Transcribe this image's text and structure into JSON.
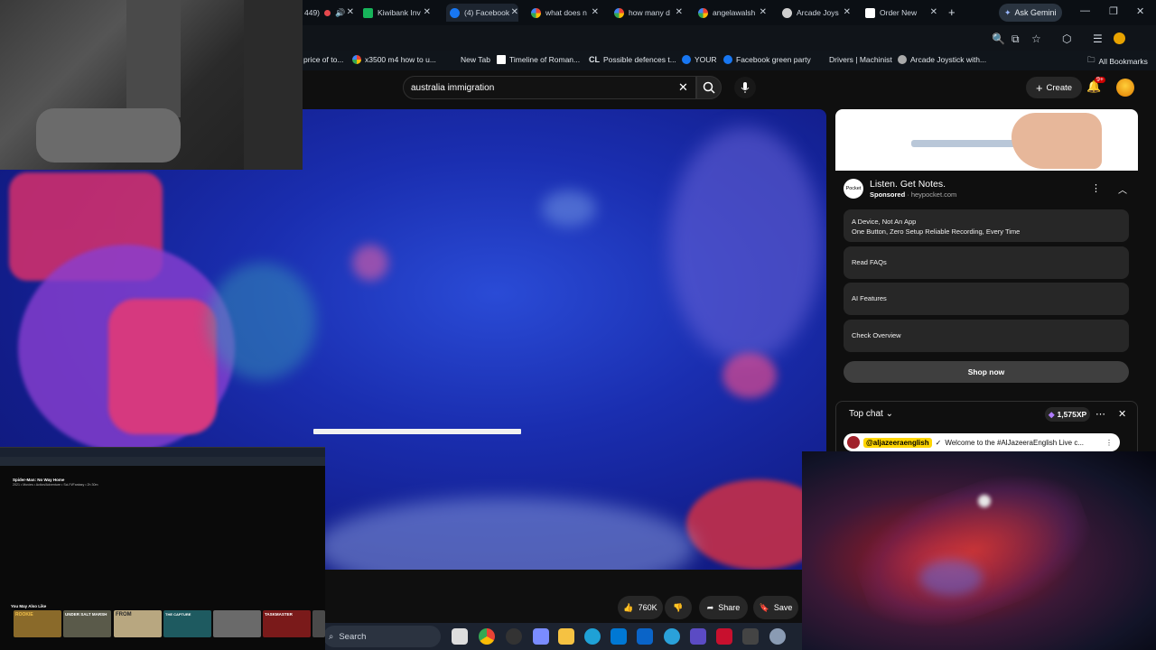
{
  "browser": {
    "tabs": [
      {
        "label": "449)"
      },
      {
        "label": "Kiwibank Inv"
      },
      {
        "label": "(4) Facebook"
      },
      {
        "label": "what does n"
      },
      {
        "label": "how many d"
      },
      {
        "label": "angelawalsh"
      },
      {
        "label": "Arcade Joys"
      },
      {
        "label": "Order New"
      }
    ],
    "new_tab": "+",
    "ask_gemini": "Ask Gemini",
    "bookmarks": [
      {
        "label": "price of to..."
      },
      {
        "label": "x3500 m4 how to u..."
      },
      {
        "label": "New Tab"
      },
      {
        "label": "Timeline of Roman..."
      },
      {
        "label": "Possible defences t..."
      },
      {
        "label": "YOUR"
      },
      {
        "label": "Facebook green party"
      },
      {
        "label": "Drivers | Machinist"
      },
      {
        "label": "Arcade Joystick with..."
      }
    ],
    "all_bookmarks": "All Bookmarks"
  },
  "youtube": {
    "search": {
      "value": "australia immigration"
    },
    "create_label": "Create",
    "notifications_badge": "9+",
    "ad": {
      "title": "Listen. Get Notes.",
      "sponsored": "Sponsored",
      "domain": "heypocket.com",
      "logo_text": "Pocket",
      "rows": [
        {
          "title": "A Device, Not An App",
          "sub": "One Button, Zero Setup Reliable Recording, Every Time"
        },
        {
          "title": "Read FAQs",
          "sub": ""
        },
        {
          "title": "AI Features",
          "sub": ""
        },
        {
          "title": "Check Overview",
          "sub": ""
        }
      ],
      "cta": "Shop now"
    },
    "chat": {
      "title": "Top chat",
      "xp": "1,575XP",
      "message_handle": "@aljazeeraenglish",
      "message_text": "Welcome to the #AlJazeeraEnglish Live c..."
    },
    "actions": {
      "likes": "760K",
      "share": "Share",
      "save": "Save"
    }
  },
  "mini_screen": {
    "title": "Spider-Man: No Way Home",
    "meta": "2021 • Movies • Action/Adventure • Sci-Fi/Fantasy • 2h 30m",
    "section": "You May Also Like",
    "posters": [
      "ROOKIE",
      "UNDER SALT MARSH",
      "FROM",
      "THE CAPTURE",
      "",
      "TASKMASTER",
      ""
    ]
  },
  "taskbar": {
    "search_placeholder": "Search"
  }
}
